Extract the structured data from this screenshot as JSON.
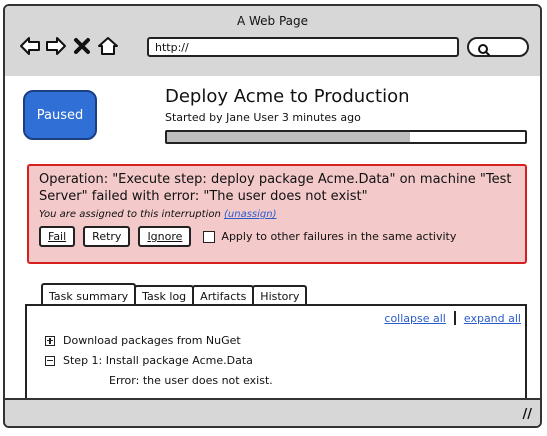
{
  "browser": {
    "title": "A Web Page",
    "url": "http://"
  },
  "deploy": {
    "status": "Paused",
    "title": "Deploy Acme to Production",
    "subtitle": "Started by Jane User 3 minutes ago",
    "progress": 0.68
  },
  "alert": {
    "message": "Operation: \"Execute step: deploy package Acme.Data\" on machine \"Test Server\" failed with error: \"The user does not exist\"",
    "assigned_text": "You are assigned to this interruption",
    "unassign_link": "(unassign)",
    "fail_label": "Fail",
    "retry_label": "Retry",
    "ignore_label": "Ignore",
    "apply_label": "Apply to other failures in the same activity"
  },
  "tabs": [
    {
      "label": "Task summary"
    },
    {
      "label": "Task log"
    },
    {
      "label": "Artifacts"
    },
    {
      "label": "History"
    }
  ],
  "panel": {
    "collapse_all": "collapse all",
    "expand_all": "expand all",
    "tasks": [
      {
        "label": "Download packages from NuGet",
        "state": "collapsed"
      },
      {
        "label": "Step 1: Install package Acme.Data",
        "state": "expanded"
      }
    ],
    "error": "Error: the user does not exist."
  },
  "status_bar": {
    "grip": "//"
  },
  "colors": {
    "paused_badge": "#2f6fd6",
    "alert_bg": "#f3c9c9",
    "alert_border": "#d62020",
    "link": "#2b5ccc",
    "chrome": "#d7d7d7"
  }
}
